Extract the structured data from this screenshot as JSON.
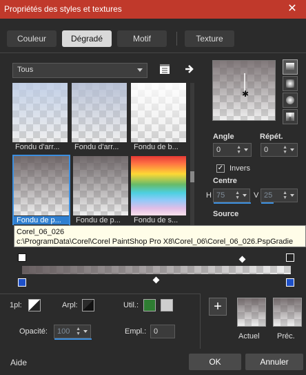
{
  "window": {
    "title": "Propriétés des styles et textures",
    "close": "✕"
  },
  "tabs": [
    {
      "label": "Couleur"
    },
    {
      "label": "Dégradé"
    },
    {
      "label": "Motif"
    },
    {
      "label": "Texture"
    }
  ],
  "library": {
    "filter": "Tous",
    "items": [
      {
        "name": "Fondu d'arr...",
        "tint": "#c7d6ea"
      },
      {
        "name": "Fondu d'arr...",
        "tint": "#bcc6d6"
      },
      {
        "name": "Fondu de b...",
        "tint": "#ffffff"
      },
      {
        "name": "Fondu de p...",
        "tint": "#6f6466"
      },
      {
        "name": "Fondu de p...",
        "tint": "#6c6465"
      },
      {
        "name": "Fondu de s...",
        "tint": "rainbow"
      }
    ],
    "tooltip_line1": "Corel_06_026",
    "tooltip_line2": "c:\\ProgramData\\Corel\\Corel PaintShop Pro X8\\Corel_06\\Corel_06_026.PspGradie"
  },
  "controls": {
    "angle_label": "Angle",
    "angle_value": "0",
    "repeat_label": "Répét.",
    "repeat_value": "0",
    "invert_label": "Invers",
    "invert_checked": "✓",
    "center_label": "Centre",
    "h_label": "H",
    "h_value": "75",
    "v_label": "V",
    "v_value": "25",
    "source_label": "Source"
  },
  "stops": {
    "fp_label": "1pl:",
    "arpl_label": "Arpl:",
    "util_label": "Util.:",
    "util_color": "#2e7d32",
    "opacity_label": "Opacité:",
    "opacity_value": "100",
    "empl_label": "Empl.:",
    "empl_value": "0"
  },
  "swatches": {
    "current_label": "Actuel",
    "previous_label": "Préc.",
    "add": "+"
  },
  "footer": {
    "help": "Aide",
    "ok": "OK",
    "cancel": "Annuler"
  },
  "colors": {
    "accent": "#3b8fe0",
    "titlebar": "#c0392b",
    "selected": "#2f7fd0"
  }
}
